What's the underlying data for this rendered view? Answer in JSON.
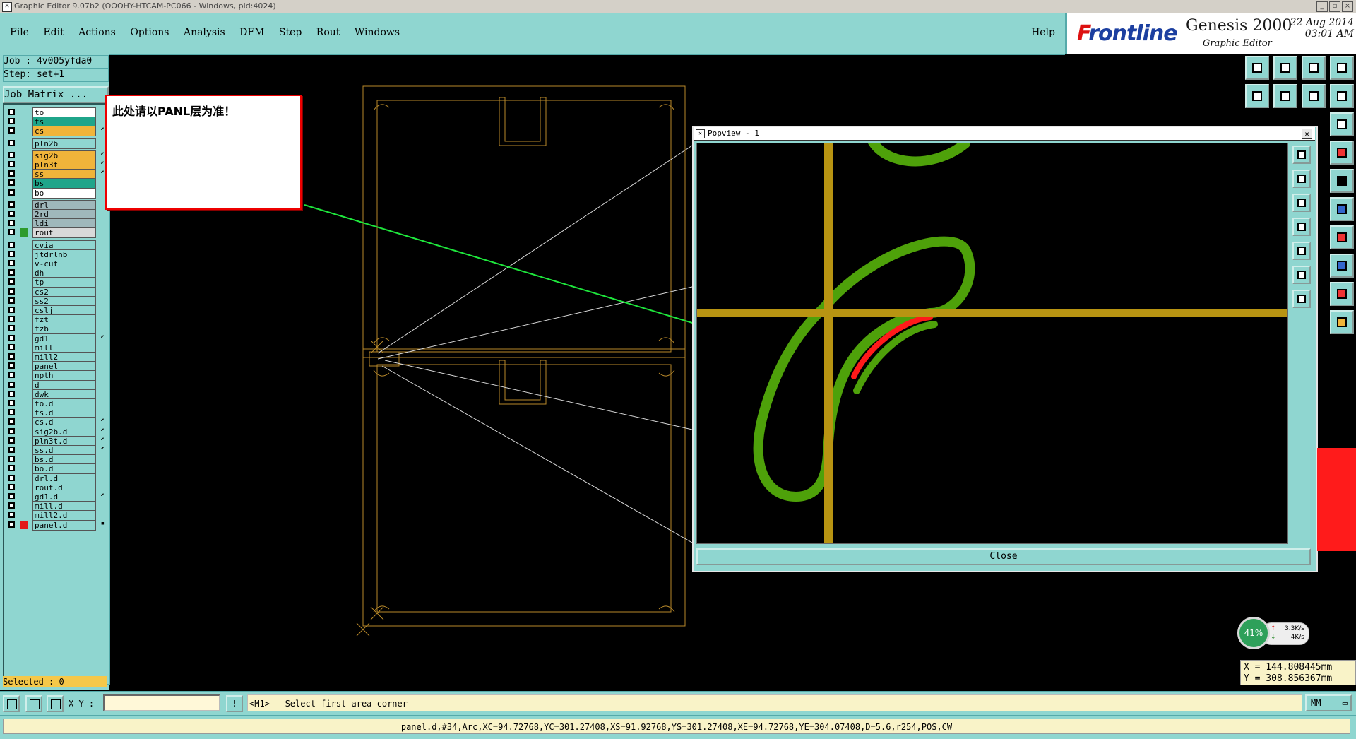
{
  "window": {
    "title": "Graphic Editor 9.07b2 (OOOHY-HTCAM-PC066 - Windows, pid:4024)"
  },
  "menu": {
    "items": [
      "File",
      "Edit",
      "Actions",
      "Options",
      "Analysis",
      "DFM",
      "Step",
      "Rout",
      "Windows"
    ],
    "help": "Help"
  },
  "brand": {
    "logo_f": "F",
    "logo_rest": "rontline",
    "product": "Genesis 2000",
    "subtitle": "Graphic Editor",
    "date": "22 Aug 2014",
    "time": "03:01 AM"
  },
  "job": {
    "job_line": "Job : 4v005yfda0",
    "step_line": "Step: set+1",
    "matrix_button": "Job Matrix ..."
  },
  "layers": [
    {
      "name": "to",
      "color": "#ffffff"
    },
    {
      "name": "ts",
      "color": "#1fa58a"
    },
    {
      "name": "cs",
      "color": "#f0b43a",
      "mark": "⬋"
    },
    {
      "name": "pln2b",
      "color": "#8fd6d0"
    },
    {
      "name": "sig2b",
      "color": "#f0b43a",
      "mark": "⬋"
    },
    {
      "name": "pln3t",
      "color": "#f0b43a",
      "mark": "⬋"
    },
    {
      "name": "ss",
      "color": "#f0b43a",
      "mark": "⬋"
    },
    {
      "name": "bs",
      "color": "#1fa58a"
    },
    {
      "name": "bo",
      "color": "#ffffff"
    },
    {
      "name": "drl",
      "color": "#9fb8bb"
    },
    {
      "name": "2rd",
      "color": "#9fb8bb"
    },
    {
      "name": "ldi",
      "color": "#9fb8bb"
    },
    {
      "name": "rout",
      "color": "#d9d9d9",
      "selcolor": "#2e9b2e"
    },
    {
      "name": "cvia",
      "color": "#8fd6d0"
    },
    {
      "name": "jtdrlnb",
      "color": "#8fd6d0"
    },
    {
      "name": "v-cut",
      "color": "#8fd6d0"
    },
    {
      "name": "dh",
      "color": "#8fd6d0"
    },
    {
      "name": "tp",
      "color": "#8fd6d0"
    },
    {
      "name": "cs2",
      "color": "#8fd6d0"
    },
    {
      "name": "ss2",
      "color": "#8fd6d0"
    },
    {
      "name": "cslj",
      "color": "#8fd6d0"
    },
    {
      "name": "fzt",
      "color": "#8fd6d0"
    },
    {
      "name": "fzb",
      "color": "#8fd6d0"
    },
    {
      "name": "gd1",
      "color": "#8fd6d0",
      "mark": "⬋"
    },
    {
      "name": "mill",
      "color": "#8fd6d0"
    },
    {
      "name": "mill2",
      "color": "#8fd6d0"
    },
    {
      "name": "panel",
      "color": "#8fd6d0"
    },
    {
      "name": "npth",
      "color": "#8fd6d0"
    },
    {
      "name": "d",
      "color": "#8fd6d0"
    },
    {
      "name": "dwk",
      "color": "#8fd6d0"
    },
    {
      "name": "to.d",
      "color": "#8fd6d0"
    },
    {
      "name": "ts.d",
      "color": "#8fd6d0"
    },
    {
      "name": "cs.d",
      "color": "#8fd6d0",
      "mark": "⬋"
    },
    {
      "name": "sig2b.d",
      "color": "#8fd6d0",
      "mark": "⬋"
    },
    {
      "name": "pln3t.d",
      "color": "#8fd6d0",
      "mark": "⬋"
    },
    {
      "name": "ss.d",
      "color": "#8fd6d0",
      "mark": "⬋"
    },
    {
      "name": "bs.d",
      "color": "#8fd6d0"
    },
    {
      "name": "bo.d",
      "color": "#8fd6d0"
    },
    {
      "name": "drl.d",
      "color": "#8fd6d0"
    },
    {
      "name": "rout.d",
      "color": "#8fd6d0"
    },
    {
      "name": "gd1.d",
      "color": "#8fd6d0",
      "mark": "⬋"
    },
    {
      "name": "mill.d",
      "color": "#8fd6d0"
    },
    {
      "name": "mill2.d",
      "color": "#8fd6d0"
    },
    {
      "name": "panel.d",
      "color": "#8fd6d0",
      "selcolor": "#e21a1a",
      "mark": "▪"
    }
  ],
  "selected": "Selected : 0",
  "callout": {
    "text": "此处请以PANL层为准！"
  },
  "popview": {
    "title": "Popview - 1",
    "close": "Close",
    "close_x": "×"
  },
  "colors": {
    "trace": "#b89412",
    "outline": "#4ea10a",
    "highlight": "#ff1a1a",
    "arrow": "#1ee63c",
    "board": "#b8892a"
  },
  "netmeter": {
    "percent": "41%",
    "up": "3.3K/s",
    "down": "4K/s"
  },
  "coords": {
    "x": "X = 144.808445mm",
    "y": "Y = 308.856367mm"
  },
  "statusbar": {
    "xy_label": "X Y :",
    "xy_value": "",
    "warn": "!",
    "prompt": "<M1> - Select first area corner",
    "units": "MM"
  },
  "info": "panel.d,#34,Arc,XC=94.72768,YC=301.27408,XS=91.92768,YS=301.27408,XE=94.72768,YE=304.07408,D=5.6,r254,POS,CW"
}
